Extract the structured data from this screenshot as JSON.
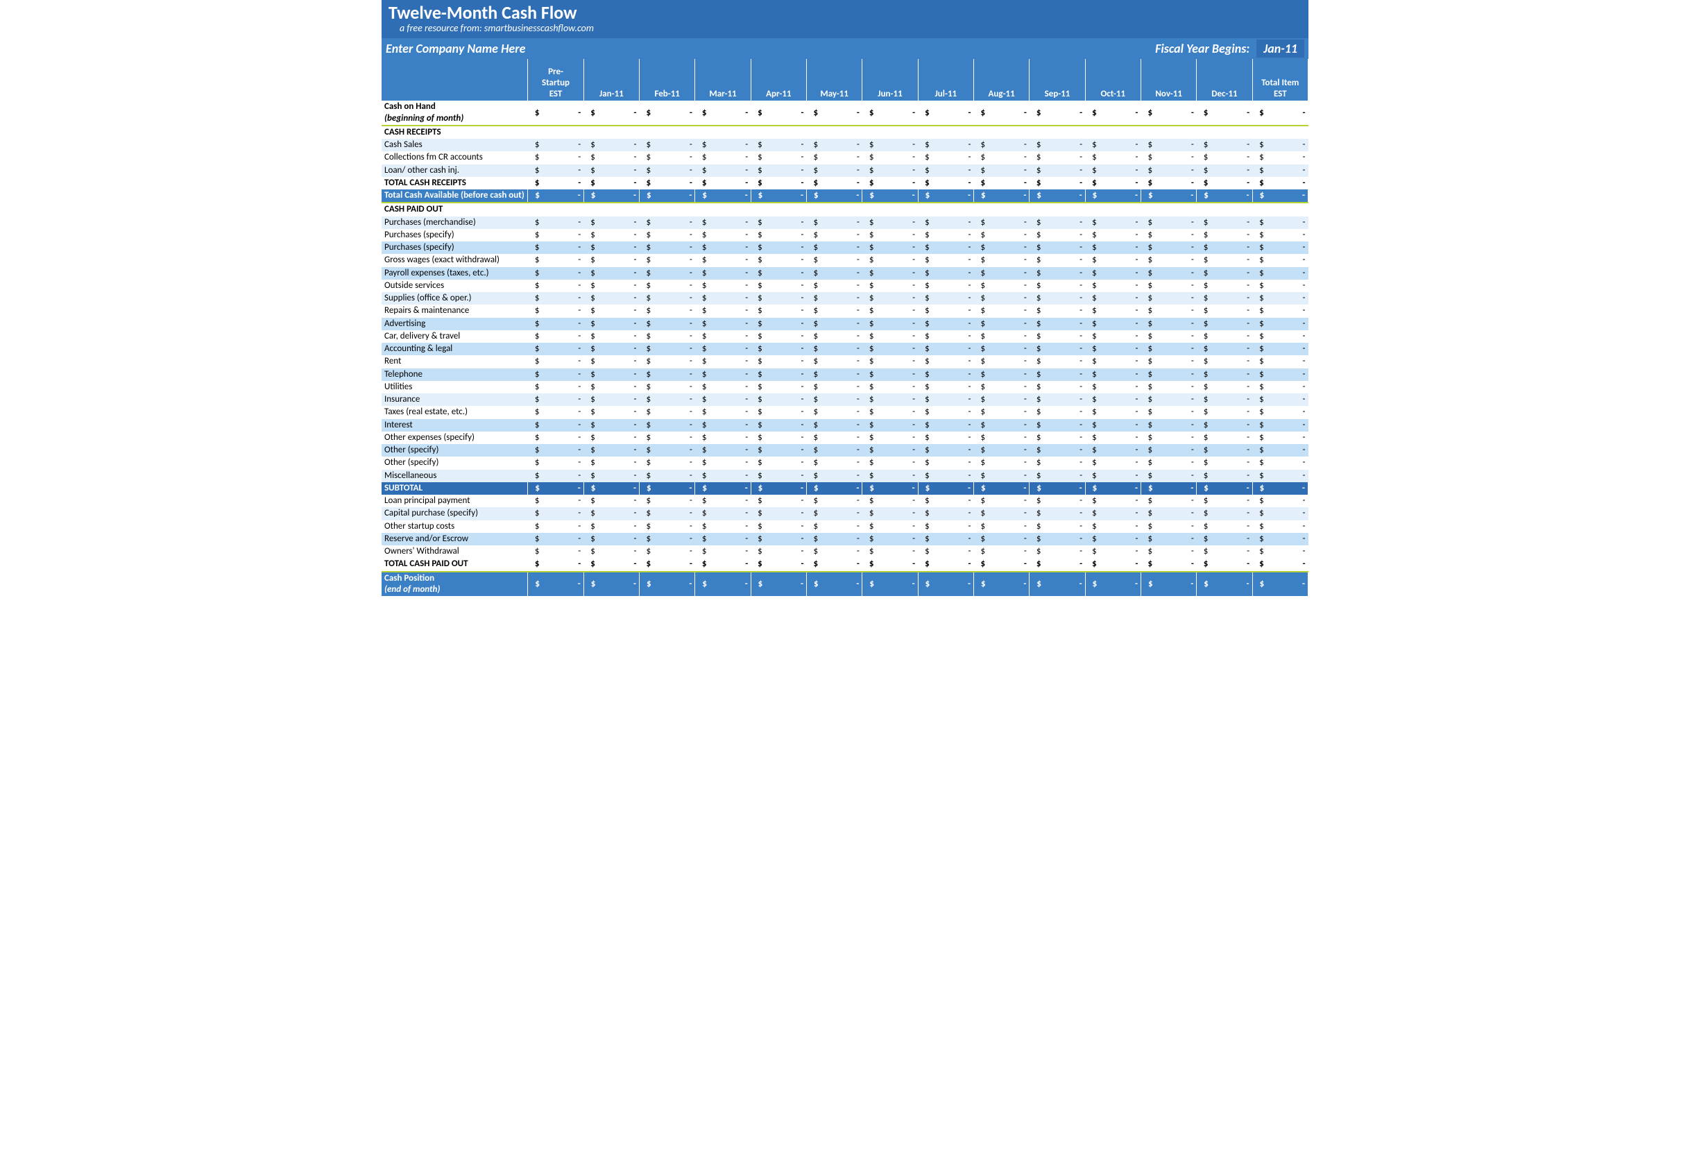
{
  "title": "Twelve-Month Cash Flow",
  "subtitle_prefix": "a free resource from:  ",
  "subtitle_link": "smartbusinesscashflow.com",
  "company_name": "Enter Company Name Here",
  "fiscal_year_label": "Fiscal Year Begins:",
  "fiscal_year_value": "Jan-11",
  "columns": [
    "",
    "Pre-Startup EST",
    "Jan-11",
    "Feb-11",
    "Mar-11",
    "Apr-11",
    "May-11",
    "Jun-11",
    "Jul-11",
    "Aug-11",
    "Sep-11",
    "Oct-11",
    "Nov-11",
    "Dec-11",
    "Total Item EST"
  ],
  "sections": [
    {
      "kind": "labelrow",
      "cls": "white boldrow",
      "label_html": "Cash on Hand<br><span class=\"ital\">(beginning of month)</span>",
      "name": "cash-on-hand",
      "amount": "$ -",
      "sep_after": true
    },
    {
      "kind": "labelrow",
      "cls": "white boldrow",
      "label": "CASH RECEIPTS",
      "name": "section-cash-receipts",
      "no_amounts": true
    },
    {
      "kind": "datarow",
      "cls": "band0",
      "label": "Cash Sales",
      "name": "cash-sales"
    },
    {
      "kind": "datarow",
      "cls": "white",
      "label": "Collections fm CR accounts",
      "name": "collections-cr-accounts"
    },
    {
      "kind": "datarow",
      "cls": "band0",
      "label": "Loan/ other cash inj.",
      "name": "loan-other-cash-inj"
    },
    {
      "kind": "datarow",
      "cls": "white boldrow",
      "label": "TOTAL CASH RECEIPTS",
      "name": "total-cash-receipts"
    },
    {
      "kind": "labelrow",
      "cls": "midband",
      "label_html": "Total Cash Available (before cash out)",
      "name": "total-cash-available",
      "amount": "$ -",
      "wrap": true,
      "sep_after": true
    },
    {
      "kind": "labelrow",
      "cls": "white boldrow",
      "label": "CASH PAID OUT",
      "name": "section-cash-paid-out",
      "no_amounts": true
    },
    {
      "kind": "datarow",
      "cls": "band0",
      "label": "Purchases (merchandise)",
      "name": "purchases-merchandise"
    },
    {
      "kind": "datarow",
      "cls": "white",
      "label": "Purchases (specify)",
      "name": "purchases-specify-1"
    },
    {
      "kind": "datarow",
      "cls": "band1",
      "label": "Purchases (specify)",
      "name": "purchases-specify-2"
    },
    {
      "kind": "datarow",
      "cls": "white",
      "label": "Gross wages (exact withdrawal)",
      "name": "gross-wages"
    },
    {
      "kind": "datarow",
      "cls": "band1",
      "label": "Payroll expenses (taxes, etc.)",
      "name": "payroll-expenses"
    },
    {
      "kind": "datarow",
      "cls": "white",
      "label": "Outside services",
      "name": "outside-services"
    },
    {
      "kind": "datarow",
      "cls": "band0",
      "label": "Supplies (office & oper.)",
      "name": "supplies"
    },
    {
      "kind": "datarow",
      "cls": "white",
      "label": "Repairs & maintenance",
      "name": "repairs-maintenance"
    },
    {
      "kind": "datarow",
      "cls": "band1",
      "label": "Advertising",
      "name": "advertising"
    },
    {
      "kind": "datarow",
      "cls": "white",
      "label": "Car, delivery & travel",
      "name": "car-delivery-travel"
    },
    {
      "kind": "datarow",
      "cls": "band1",
      "label": "Accounting & legal",
      "name": "accounting-legal"
    },
    {
      "kind": "datarow",
      "cls": "white",
      "label": "Rent",
      "name": "rent"
    },
    {
      "kind": "datarow",
      "cls": "band1",
      "label": "Telephone",
      "name": "telephone"
    },
    {
      "kind": "datarow",
      "cls": "white",
      "label": "Utilities",
      "name": "utilities"
    },
    {
      "kind": "datarow",
      "cls": "band0",
      "label": "Insurance",
      "name": "insurance"
    },
    {
      "kind": "datarow",
      "cls": "white",
      "label": "Taxes (real estate, etc.)",
      "name": "taxes"
    },
    {
      "kind": "datarow",
      "cls": "band1",
      "label": "Interest",
      "name": "interest"
    },
    {
      "kind": "datarow",
      "cls": "white",
      "label": "Other expenses (specify)",
      "name": "other-expenses"
    },
    {
      "kind": "datarow",
      "cls": "band1",
      "label": "Other (specify)",
      "name": "other-specify-1"
    },
    {
      "kind": "datarow",
      "cls": "white",
      "label": "Other (specify)",
      "name": "other-specify-2"
    },
    {
      "kind": "datarow",
      "cls": "band0",
      "label": "Miscellaneous",
      "name": "miscellaneous"
    },
    {
      "kind": "datarow",
      "cls": "darkband",
      "label": "SUBTOTAL",
      "name": "subtotal"
    },
    {
      "kind": "datarow",
      "cls": "white",
      "label": "Loan principal payment",
      "name": "loan-principal-payment"
    },
    {
      "kind": "datarow",
      "cls": "band0",
      "label": "Capital purchase (specify)",
      "name": "capital-purchase"
    },
    {
      "kind": "datarow",
      "cls": "white",
      "label": "Other startup costs",
      "name": "other-startup-costs"
    },
    {
      "kind": "datarow",
      "cls": "band1",
      "label": "Reserve and/or Escrow",
      "name": "reserve-escrow"
    },
    {
      "kind": "datarow",
      "cls": "white",
      "label": "Owners' Withdrawal",
      "name": "owners-withdrawal"
    },
    {
      "kind": "datarow",
      "cls": "white boldrow",
      "label": "TOTAL CASH PAID OUT",
      "name": "total-cash-paid-out",
      "sep_after": true
    },
    {
      "kind": "labelrow",
      "cls": "midband",
      "label_html": "Cash Position<br><span class=\"ital\">(end of month)</span>",
      "name": "cash-position",
      "amount": "$ -",
      "wrap": true
    }
  ],
  "amount_display": {
    "currency": "$",
    "dash": "-"
  }
}
